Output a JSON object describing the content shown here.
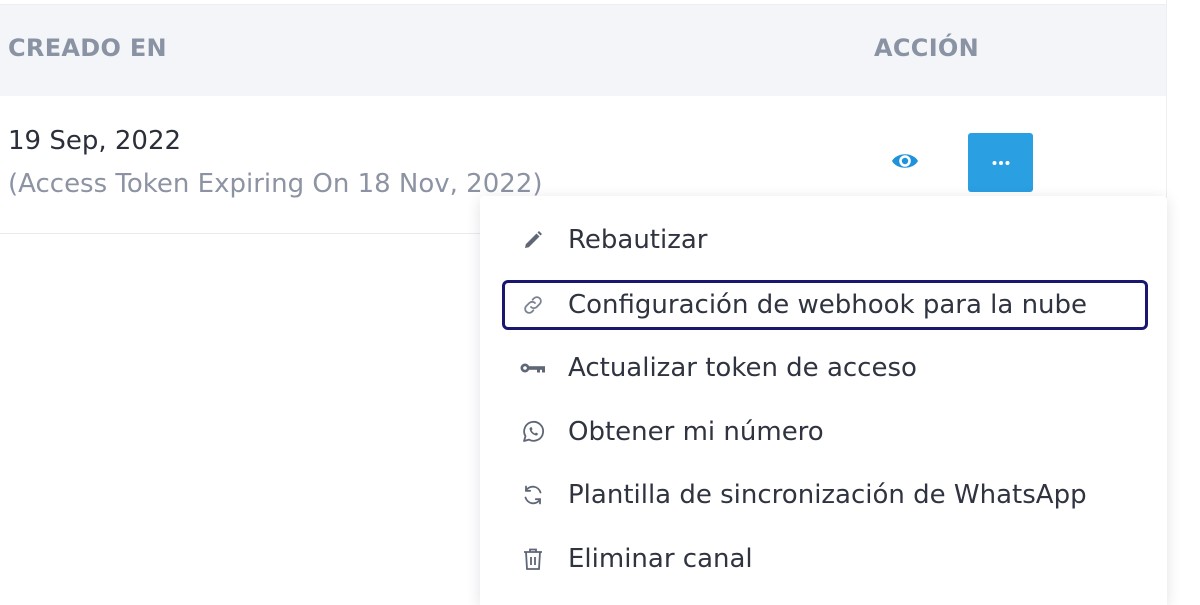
{
  "table": {
    "headers": {
      "created": "CREADO EN",
      "action": "ACCIÓN"
    },
    "rows": [
      {
        "created_date": "19 Sep, 2022",
        "token_expiry": "(Access Token Expiring On 18 Nov, 2022)"
      }
    ]
  },
  "actions": {
    "view_icon": "eye-icon",
    "more_icon": "more-horizontal-icon",
    "more_button_color": "#2a9fe2"
  },
  "menu": {
    "items": [
      {
        "label": "Rebautizar",
        "icon": "pencil-icon"
      },
      {
        "label": "Configuración de webhook para la nube",
        "icon": "link-icon",
        "highlighted": true
      },
      {
        "label": "Actualizar token de acceso",
        "icon": "key-icon"
      },
      {
        "label": "Obtener mi número",
        "icon": "whatsapp-icon"
      },
      {
        "label": "Plantilla de sincronización de WhatsApp",
        "icon": "sync-icon"
      },
      {
        "label": "Eliminar canal",
        "icon": "trash-icon"
      }
    ],
    "highlight_color": "#1a1770"
  }
}
